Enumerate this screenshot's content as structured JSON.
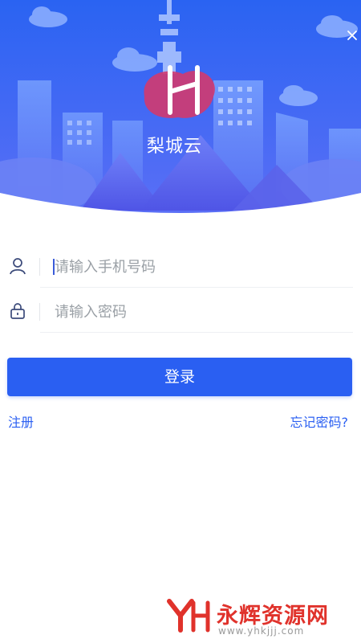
{
  "header": {
    "app_name": "梨城云",
    "close_icon": "close-icon",
    "logo_letter": "H",
    "colors": {
      "sky_top": "#2a63f2",
      "sky_bottom": "#5a6cf6",
      "logo_accent": "#d13a6f"
    }
  },
  "form": {
    "phone": {
      "placeholder": "请输入手机号码",
      "value": "",
      "icon": "user-icon"
    },
    "password": {
      "placeholder": "请输入密码",
      "value": "",
      "icon": "lock-icon"
    }
  },
  "actions": {
    "login_label": "登录",
    "register_label": "注册",
    "forgot_label": "忘记密码?"
  },
  "watermark": {
    "text": "永辉资源网",
    "url": "www.yhkjjj.com",
    "logo": "yh-logo"
  }
}
